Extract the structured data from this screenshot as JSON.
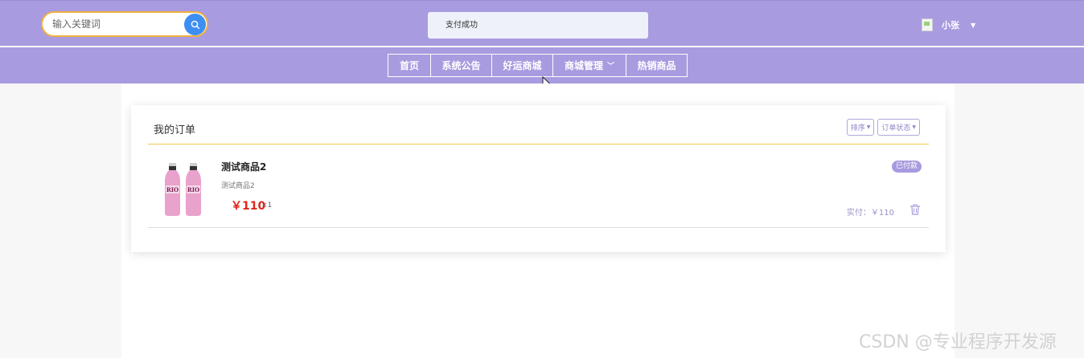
{
  "search": {
    "placeholder": "输入关键词",
    "button_icon": "search-icon"
  },
  "toast": {
    "message": "支付成功"
  },
  "user": {
    "name": "小张",
    "dropdown_icon": "caret-down-icon"
  },
  "nav": {
    "items": [
      {
        "label": "首页"
      },
      {
        "label": "系统公告"
      },
      {
        "label": "好运商城"
      },
      {
        "label": "商城管理",
        "icon": "chevron-down-icon"
      },
      {
        "label": "热销商品"
      }
    ]
  },
  "orders": {
    "title": "我的订单",
    "filters": {
      "sort_label": "排序",
      "status_label": "订单状态"
    },
    "items": [
      {
        "name": "测试商品2",
        "description": "测试商品2",
        "price": "￥110",
        "quantity": "×1",
        "status": "已付款",
        "paid": "实付：￥110",
        "image_icon": "product-bottles-image",
        "delete_icon": "trash-icon"
      }
    ]
  },
  "watermark": "CSDN @专业程序开发源",
  "colors": {
    "header": "#a99bdf",
    "price": "#e2231a",
    "search_button": "#3d8ef0",
    "search_border": "#f0b040"
  }
}
